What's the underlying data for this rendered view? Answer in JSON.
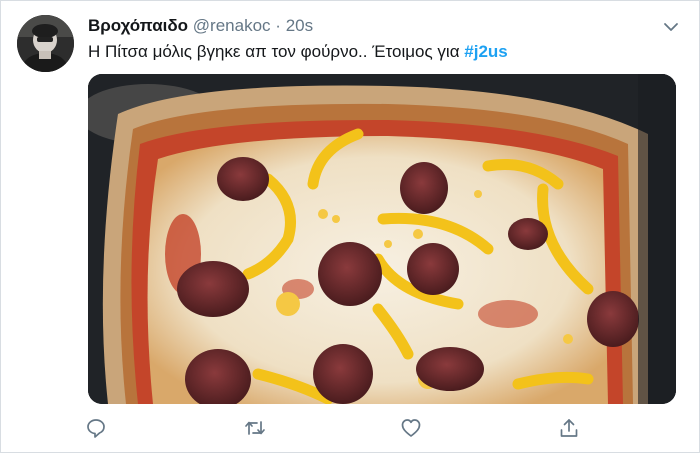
{
  "tweet": {
    "display_name": "Βροχόπαιδο",
    "handle": "@renakoc",
    "separator": "·",
    "time": "20s",
    "text": "Η Πίτσα μόλις βγηκε απ τον φούρνο.. Έτοιμος για ",
    "hashtag": "#j2us"
  },
  "icons": {
    "avatar": "avatar-photo",
    "menu": "chevron-down-icon",
    "reply": "reply-icon",
    "retweet": "retweet-icon",
    "like": "heart-icon",
    "share": "share-icon"
  },
  "colors": {
    "name": "#14171a",
    "secondary": "#657786",
    "link": "#1da1f2"
  }
}
